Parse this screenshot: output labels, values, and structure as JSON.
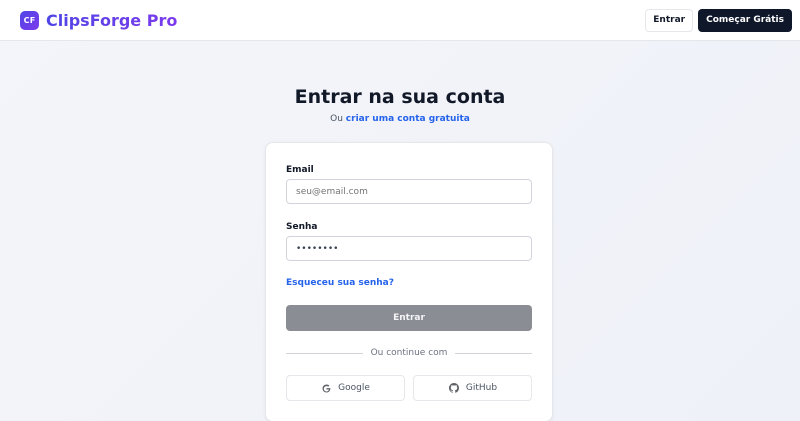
{
  "header": {
    "logo_text": "CF",
    "brand_name": "ClipsForge Pro",
    "login_label": "Entrar",
    "start_label": "Começar Grátis"
  },
  "main": {
    "title": "Entrar na sua conta",
    "subtitle_prefix": "Ou",
    "create_account_link": "criar uma conta gratuita"
  },
  "form": {
    "email_label": "Email",
    "email_placeholder": "seu@email.com",
    "password_label": "Senha",
    "password_value": "••••••••",
    "forgot_link": "Esqueceu sua senha?",
    "submit_label": "Entrar",
    "divider_text": "Ou continue com",
    "google_label": "Google",
    "github_label": "GitHub"
  },
  "icons": {
    "google": "google-icon",
    "github": "github-icon"
  },
  "colors": {
    "brand_gradient_start": "#4f46e5",
    "brand_gradient_end": "#7c3aed",
    "link": "#2563eb",
    "primary_dark": "#0f172a",
    "submit_disabled": "#8a8d93"
  }
}
